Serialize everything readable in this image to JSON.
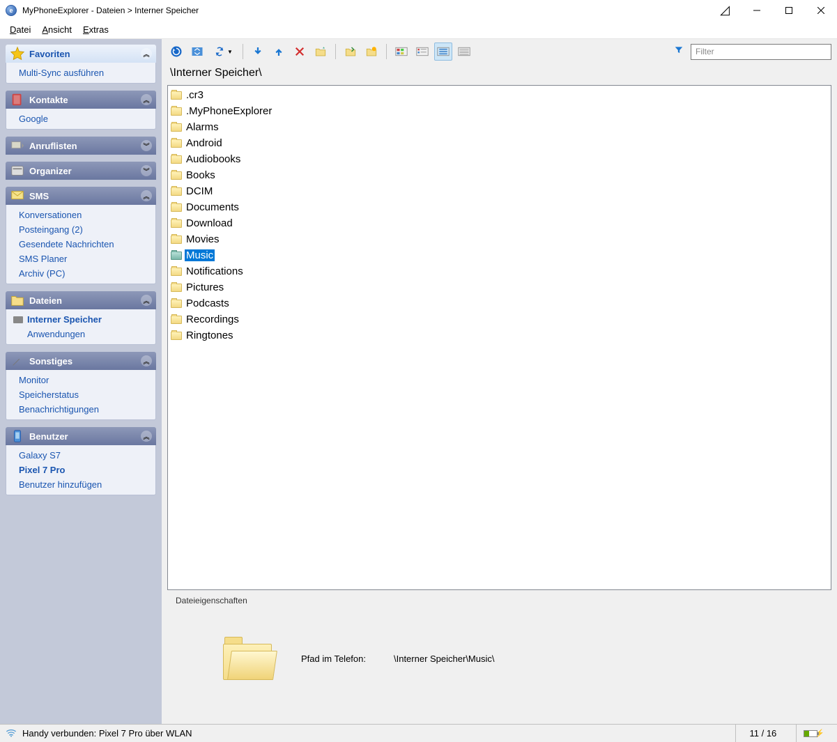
{
  "window": {
    "title": "MyPhoneExplorer -  Dateien > Interner Speicher"
  },
  "menu": {
    "datei": "Datei",
    "ansicht": "Ansicht",
    "extras": "Extras"
  },
  "sidebar": {
    "favoriten": {
      "title": "Favoriten",
      "items": [
        "Multi-Sync ausführen"
      ]
    },
    "kontakte": {
      "title": "Kontakte",
      "items": [
        "Google"
      ]
    },
    "anruflisten": {
      "title": "Anruflisten"
    },
    "organizer": {
      "title": "Organizer"
    },
    "sms": {
      "title": "SMS",
      "items": [
        "Konversationen",
        "Posteingang (2)",
        "Gesendete Nachrichten",
        "SMS Planer",
        "Archiv (PC)"
      ]
    },
    "dateien": {
      "title": "Dateien",
      "items": [
        "Interner Speicher",
        "Anwendungen"
      ],
      "active_index": 0
    },
    "sonstiges": {
      "title": "Sonstiges",
      "items": [
        "Monitor",
        "Speicherstatus",
        "Benachrichtigungen"
      ]
    },
    "benutzer": {
      "title": "Benutzer",
      "items": [
        "Galaxy S7",
        "Pixel 7 Pro",
        "Benutzer hinzufügen"
      ],
      "active_index": 1
    }
  },
  "toolbar": {
    "filter_placeholder": "Filter"
  },
  "path": "\\Interner Speicher\\",
  "folders": [
    ".cr3",
    ".MyPhoneExplorer",
    "Alarms",
    "Android",
    "Audiobooks",
    "Books",
    "DCIM",
    "Documents",
    "Download",
    "Movies",
    "Music",
    "Notifications",
    "Pictures",
    "Podcasts",
    "Recordings",
    "Ringtones"
  ],
  "selected_folder": "Music",
  "props": {
    "title": "Dateieigenschaften",
    "path_label": "Pfad im Telefon:",
    "path_value": "\\Interner Speicher\\Music\\"
  },
  "status": {
    "text": "Handy verbunden: Pixel 7 Pro über WLAN",
    "count": "11 / 16"
  }
}
